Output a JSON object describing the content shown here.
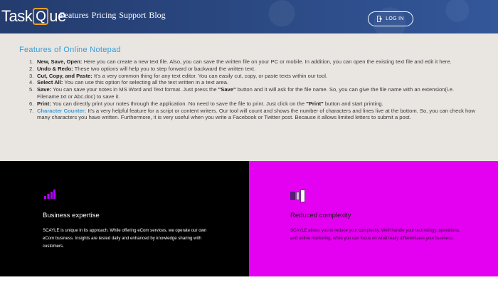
{
  "header": {
    "logo_part1": "Task",
    "logo_q": "Q",
    "logo_part2": "ue",
    "nav": [
      "Features",
      "Pricing",
      "Support",
      "Blog"
    ],
    "login_label": "LOG IN"
  },
  "features": {
    "heading": "Features of Online Notepad",
    "items": [
      {
        "num": "1.",
        "term": "New, Save, Open:",
        "text": " Here you can create a new text file. Also, you can save the written file on your PC or mobile. In addition, you can open the existing text file and edit it here."
      },
      {
        "num": "2.",
        "term": "Undo & Redo:",
        "text": " These two options will help you to step forward or backward the written text."
      },
      {
        "num": "3.",
        "term": "Cut, Copy, and Paste:",
        "text": " It's a very common thing for any text editor. You can easily cut, copy, or paste texts within our tool."
      },
      {
        "num": "4.",
        "term": "Select All:",
        "text": " You can use this option for selecting all the text written in a text area."
      },
      {
        "num": "5.",
        "term": "Save:",
        "text_before": " You can save your notes in MS Word and Text format. Just press the ",
        "quoted": "\"Save\"",
        "text_after": " button and it will ask for the file name. So, you can give the file name with an extension(i.e. Filename.txt or Abc.doc) to save it."
      },
      {
        "num": "6.",
        "term": "Print:",
        "text_before": " You can directly print your notes through the application. No need to save the file to print. Just click on the ",
        "quoted": "\"Print\"",
        "text_after": " button and start printing."
      },
      {
        "num": "7.",
        "term": "Character Counter:",
        "text": " It's a very helpful feature for a script or content writers. Our tool will count and shows the number of characters and lines live at the bottom. So, you can check how many characters you have written. Furthermore, it is very useful when you write a Facebook or Twitter post. Because it allows limited letters to submit a post."
      }
    ]
  },
  "panels": {
    "left": {
      "icon": "bar-chart-icon",
      "title": "Business expertise",
      "text": "SCAYLE is unique in its approach. While offering eCom services, we operate our own eCom business. Insights are tested daily and enhanced by knowledge sharing with customers."
    },
    "right": {
      "icon": "panels-icon",
      "title": "Reduced complexity",
      "text": "SCAYLE allows you to reduce your complexity. We'll handle your technology, operations, and online marketing, while you can focus on what really differentiates your business."
    }
  },
  "colors": {
    "header_bg": "#2a4780",
    "logo_accent": "#f5a020",
    "feature_heading": "#3a9bd5",
    "features_bg": "#e9e6e2",
    "panel_left_bg": "#000000",
    "panel_right_bg": "#e400f0",
    "icon_accent": "#b400ff"
  }
}
